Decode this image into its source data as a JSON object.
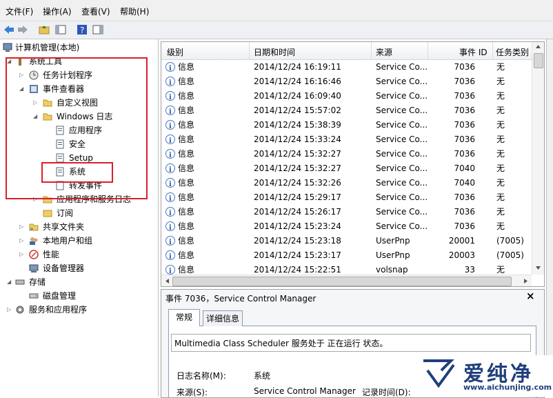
{
  "menu": [
    "文件(F)",
    "操作(A)",
    "查看(V)",
    "帮助(H)"
  ],
  "tree": {
    "root": "计算机管理(本地)",
    "system_tools": "系统工具",
    "task_scheduler": "任务计划程序",
    "event_viewer": "事件查看器",
    "custom_views": "自定义视图",
    "windows_logs": "Windows 日志",
    "application": "应用程序",
    "security": "安全",
    "setup": "Setup",
    "system": "系统",
    "forwarded": "转发事件",
    "app_service_logs": "应用程序和服务日志",
    "subscriptions": "订阅",
    "shared_folders": "共享文件夹",
    "local_users": "本地用户和组",
    "performance": "性能",
    "device_manager": "设备管理器",
    "storage": "存储",
    "disk_management": "磁盘管理",
    "services_apps": "服务和应用程序"
  },
  "list": {
    "columns": [
      "级别",
      "日期和时间",
      "来源",
      "事件 ID",
      "任务类别"
    ],
    "rows": [
      {
        "level": "信息",
        "time": "2014/12/24 16:19:11",
        "source": "Service Co...",
        "id": "7036",
        "cat": "无"
      },
      {
        "level": "信息",
        "time": "2014/12/24 16:16:46",
        "source": "Service Co...",
        "id": "7036",
        "cat": "无"
      },
      {
        "level": "信息",
        "time": "2014/12/24 16:09:40",
        "source": "Service Co...",
        "id": "7036",
        "cat": "无"
      },
      {
        "level": "信息",
        "time": "2014/12/24 15:57:02",
        "source": "Service Co...",
        "id": "7036",
        "cat": "无"
      },
      {
        "level": "信息",
        "time": "2014/12/24 15:38:39",
        "source": "Service Co...",
        "id": "7036",
        "cat": "无"
      },
      {
        "level": "信息",
        "time": "2014/12/24 15:33:24",
        "source": "Service Co...",
        "id": "7036",
        "cat": "无"
      },
      {
        "level": "信息",
        "time": "2014/12/24 15:32:27",
        "source": "Service Co...",
        "id": "7036",
        "cat": "无"
      },
      {
        "level": "信息",
        "time": "2014/12/24 15:32:27",
        "source": "Service Co...",
        "id": "7040",
        "cat": "无"
      },
      {
        "level": "信息",
        "time": "2014/12/24 15:32:26",
        "source": "Service Co...",
        "id": "7040",
        "cat": "无"
      },
      {
        "level": "信息",
        "time": "2014/12/24 15:29:17",
        "source": "Service Co...",
        "id": "7036",
        "cat": "无"
      },
      {
        "level": "信息",
        "time": "2014/12/24 15:26:17",
        "source": "Service Co...",
        "id": "7036",
        "cat": "无"
      },
      {
        "level": "信息",
        "time": "2014/12/24 15:23:24",
        "source": "Service Co...",
        "id": "7036",
        "cat": "无"
      },
      {
        "level": "信息",
        "time": "2014/12/24 15:23:18",
        "source": "UserPnp",
        "id": "20001",
        "cat": "(7005)"
      },
      {
        "level": "信息",
        "time": "2014/12/24 15:23:17",
        "source": "UserPnp",
        "id": "20003",
        "cat": "(7005)"
      },
      {
        "level": "信息",
        "time": "2014/12/24 15:22:51",
        "source": "volsnap",
        "id": "33",
        "cat": "无"
      }
    ]
  },
  "detail": {
    "title": "事件 7036，Service Control Manager",
    "tab_general": "常规",
    "tab_details": "详细信息",
    "description": "Multimedia Class Scheduler 服务处于 正在运行 状态。",
    "log_name_label": "日志名称(M):",
    "log_name_value": "系统",
    "source_label": "来源(S):",
    "source_value": "Service Control Manager",
    "logged_label": "记录时间(D):"
  },
  "watermark": {
    "brand": "爱纯净",
    "url": "www.aichunjing.com"
  },
  "colors": {
    "highlight_box": "#d6202a",
    "info_icon": "#2a5db0"
  }
}
